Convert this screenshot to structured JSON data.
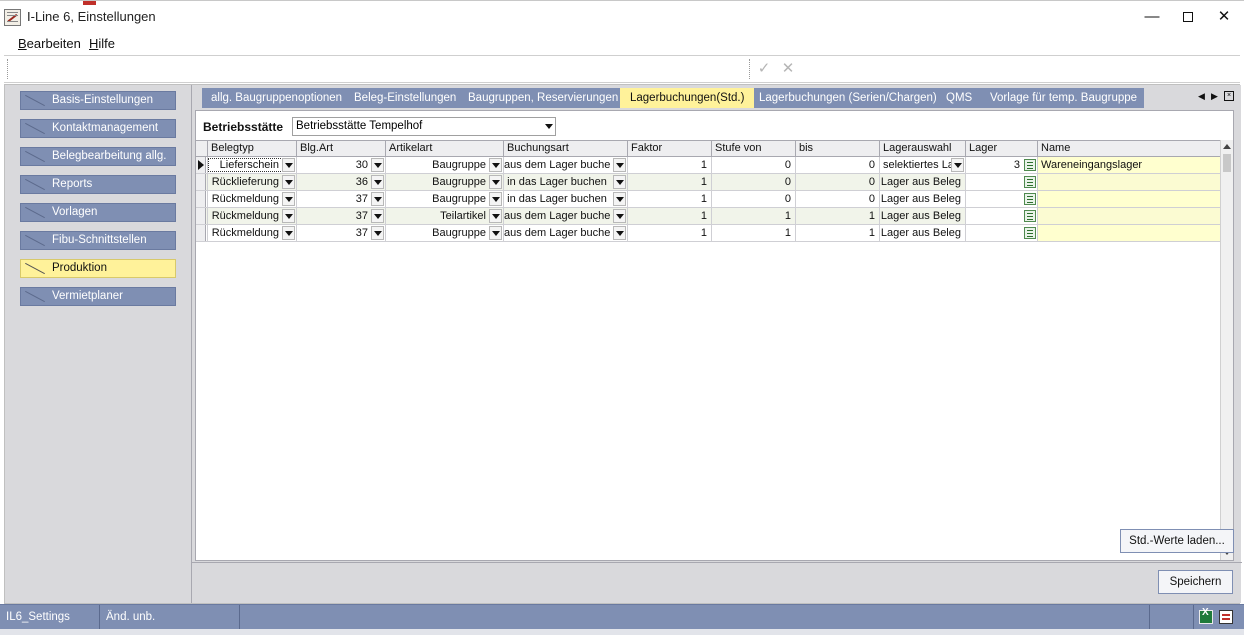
{
  "window": {
    "title": "I-Line 6, Einstellungen",
    "min_glyph": "—",
    "close_glyph": "✕"
  },
  "menu": {
    "bearbeiten_mnemonic": "B",
    "bearbeiten_rest": "earbeiten",
    "hilfe_mnemonic": "H",
    "hilfe_rest": "ilfe"
  },
  "toolbar": {
    "ok_glyph": "✓",
    "cancel_glyph": "✕"
  },
  "nav": {
    "items": [
      {
        "label": "Basis-Einstellungen",
        "active": false
      },
      {
        "label": "Kontaktmanagement",
        "active": false
      },
      {
        "label": "Belegbearbeitung allg.",
        "active": false
      },
      {
        "label": "Reports",
        "active": false
      },
      {
        "label": "Vorlagen",
        "active": false
      },
      {
        "label": "Fibu-Schnittstellen",
        "active": false
      },
      {
        "label": "Produktion",
        "active": true
      },
      {
        "label": "Vermietplaner",
        "active": false
      }
    ]
  },
  "tabs": {
    "items": [
      {
        "label": "allg. Baugruppenoptionen",
        "active": false
      },
      {
        "label": "Beleg-Einstellungen",
        "active": false
      },
      {
        "label": "Baugruppen, Reservierungen",
        "active": false
      },
      {
        "label": "Lagerbuchungen(Std.)",
        "active": true
      },
      {
        "label": "Lagerbuchungen (Serien/Chargen)",
        "active": false
      },
      {
        "label": "QMS",
        "active": false
      },
      {
        "label": "Vorlage für temp. Baugruppe",
        "active": false
      }
    ],
    "prev_glyph": "◀",
    "next_glyph": "▶"
  },
  "form": {
    "betriebsstaette_label": "Betriebsstätte",
    "betriebsstaette_value": "Betriebsstätte Tempelhof"
  },
  "grid": {
    "columns": [
      "Belegtyp",
      "Blg.Art",
      "Artikelart",
      "Buchungsart",
      "Faktor",
      "Stufe von",
      "bis",
      "Lagerauswahl",
      "Lager",
      "Name"
    ],
    "rows": [
      {
        "belegtyp": "Lieferschein",
        "blgart": "30",
        "artikelart": "Baugruppe",
        "buchungsart": "aus dem Lager buche",
        "faktor": "1",
        "stufe_von": "0",
        "bis": "0",
        "lagerauswahl": "selektiertes La",
        "lager": "3",
        "name": "Wareneingangslager",
        "current": true
      },
      {
        "belegtyp": "Rücklieferung",
        "blgart": "36",
        "artikelart": "Baugruppe",
        "buchungsart": "in das Lager buchen",
        "faktor": "1",
        "stufe_von": "0",
        "bis": "0",
        "lagerauswahl": "Lager aus Beleg",
        "lager": "",
        "name": "",
        "current": false
      },
      {
        "belegtyp": "Rückmeldung",
        "blgart": "37",
        "artikelart": "Baugruppe",
        "buchungsart": "in das Lager buchen",
        "faktor": "1",
        "stufe_von": "0",
        "bis": "0",
        "lagerauswahl": "Lager aus Beleg",
        "lager": "",
        "name": "",
        "current": false
      },
      {
        "belegtyp": "Rückmeldung",
        "blgart": "37",
        "artikelart": "Teilartikel",
        "buchungsart": "aus dem Lager buche",
        "faktor": "1",
        "stufe_von": "1",
        "bis": "1",
        "lagerauswahl": "Lager aus Beleg",
        "lager": "",
        "name": "",
        "current": false
      },
      {
        "belegtyp": "Rückmeldung",
        "blgart": "37",
        "artikelart": "Baugruppe",
        "buchungsart": "aus dem Lager buche",
        "faktor": "1",
        "stufe_von": "1",
        "bis": "1",
        "lagerauswahl": "Lager aus Beleg",
        "lager": "",
        "name": "",
        "current": false
      }
    ]
  },
  "buttons": {
    "std_werte": "Std.-Werte laden...",
    "speichern": "Speichern"
  },
  "status": {
    "settings": "IL6_Settings",
    "changes": "Änd. unb."
  },
  "colors": {
    "accent": "#7f8fb3",
    "active_tab": "#fff29a",
    "name_cell": "#ffffcf"
  }
}
